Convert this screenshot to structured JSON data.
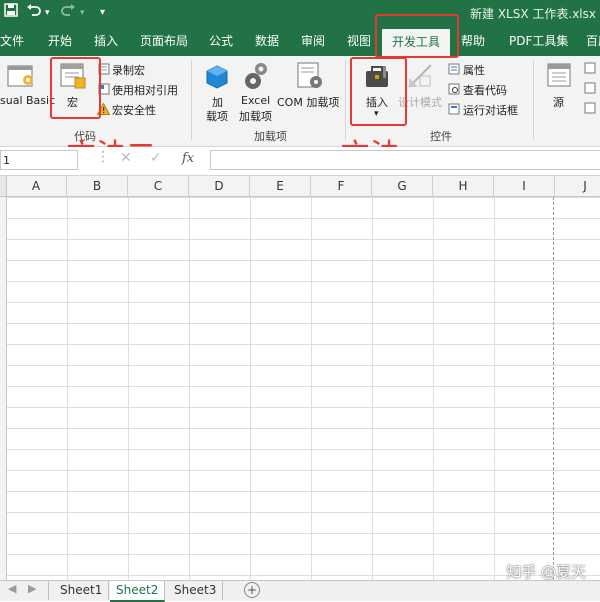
{
  "title_bar": {
    "title": "新建 XLSX 工作表.xlsx",
    "qat": {
      "save_icon": "floppy-icon",
      "undo_icon": "undo-icon",
      "redo_icon": "redo-icon",
      "more_icon": "customize-qat-icon"
    }
  },
  "tabs": [
    {
      "label": "文件"
    },
    {
      "label": "开始"
    },
    {
      "label": "插入"
    },
    {
      "label": "页面布局"
    },
    {
      "label": "公式"
    },
    {
      "label": "数据"
    },
    {
      "label": "审阅"
    },
    {
      "label": "视图"
    },
    {
      "label": "开发工具",
      "active": true
    },
    {
      "label": "帮助"
    },
    {
      "label": "PDF工具集"
    },
    {
      "label": "百度"
    }
  ],
  "ribbon": {
    "code_group": {
      "label": "代码",
      "visual_basic": "sual Basic",
      "macros": "宏",
      "record_macro": "录制宏",
      "relative_refs": "使用相对引用",
      "macro_security": "宏安全性"
    },
    "addins_group": {
      "label": "加载项",
      "addins_line1": "加",
      "addins_line2": "载项",
      "excel_addins_line1": "Excel",
      "excel_addins_line2": "加载项",
      "com_addins": "COM 加载项"
    },
    "controls_group": {
      "label": "控件",
      "insert": "插入",
      "design_mode": "设计模式",
      "properties": "属性",
      "view_code": "查看代码",
      "run_dialog": "运行对话框"
    },
    "xml_group": {
      "source": "源"
    }
  },
  "annotations": {
    "method_two": "方法二",
    "method_one": "方法一"
  },
  "formula_bar": {
    "name_box": "1",
    "fx": "fx",
    "value": ""
  },
  "grid": {
    "columns": [
      "A",
      "B",
      "C",
      "D",
      "E",
      "F",
      "G",
      "H",
      "I",
      "J"
    ]
  },
  "sheets": [
    {
      "name": "Sheet1"
    },
    {
      "name": "Sheet2",
      "active": true
    },
    {
      "name": "Sheet3"
    }
  ],
  "watermark": "知乎 @夏天",
  "colors": {
    "excel_green": "#217346",
    "annotation_red": "#e53935"
  }
}
